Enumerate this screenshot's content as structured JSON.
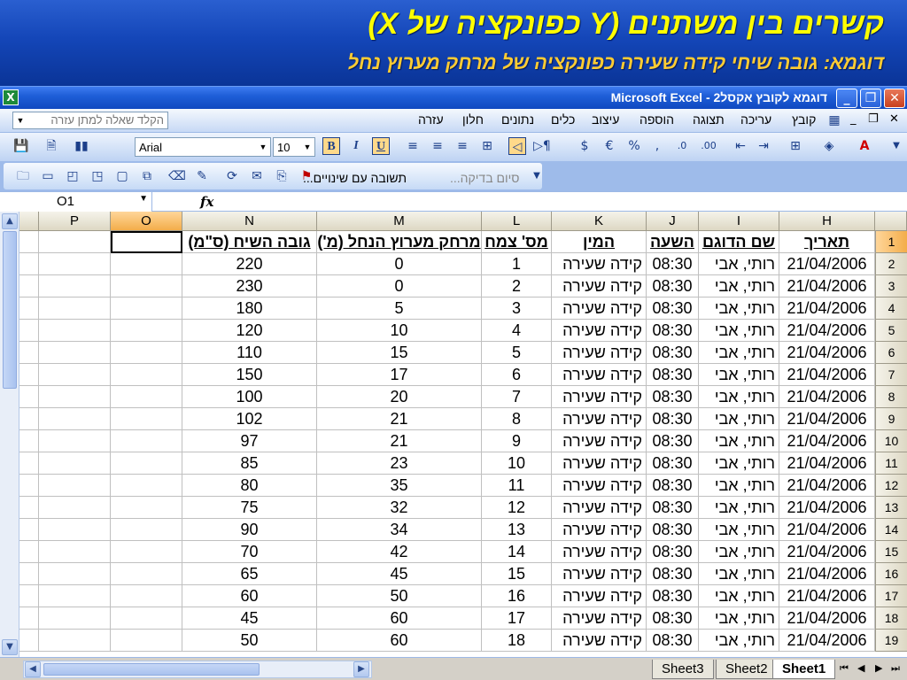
{
  "slide": {
    "title": "קשרים בין משתנים (Y כפונקציה של X)",
    "subtitle": "דוגמא: גובה שיחי קידה שעירה כפונקציה של מרחק מערוץ נחל"
  },
  "window": {
    "title": "Microsoft Excel - דוגמא לקובץ אקסל2",
    "minimize": "_",
    "restore": "❐",
    "close": "✕"
  },
  "menu": {
    "items": [
      "קובץ",
      "עריכה",
      "תצוגה",
      "הוספה",
      "עיצוב",
      "כלים",
      "נתונים",
      "חלון",
      "עזרה"
    ],
    "help_placeholder": "הקלד שאלה למתן עזרה"
  },
  "toolbar": {
    "font_name": "Arial",
    "font_size": "10",
    "bold": "B",
    "italic": "I",
    "underline": "U",
    "currency": "€",
    "percent": "%",
    "comma": ",",
    "review_reply": "תשובה עם שינויים...",
    "review_end": "סיום בדיקה..."
  },
  "formula_bar": {
    "name_box": "O1",
    "fx": "fx",
    "content": ""
  },
  "columns": [
    "H",
    "I",
    "J",
    "K",
    "L",
    "M",
    "N",
    "O",
    "P"
  ],
  "selected_column": "O",
  "headers": {
    "H": "תאריך",
    "I": "שם הדוגם",
    "J": "השעה",
    "K": "המין",
    "L": "מס' צמח",
    "M": "מרחק מערוץ הנחל (מ')",
    "N": "גובה השיח (ס\"מ)"
  },
  "rows": [
    {
      "num": "2",
      "date": "21/04/2006",
      "sampler": "רותי, אבי",
      "time": "08:30",
      "species": "קידה שעירה",
      "plant": "1",
      "distance": "0",
      "height": "220"
    },
    {
      "num": "3",
      "date": "21/04/2006",
      "sampler": "רותי, אבי",
      "time": "08:30",
      "species": "קידה שעירה",
      "plant": "2",
      "distance": "0",
      "height": "230"
    },
    {
      "num": "4",
      "date": "21/04/2006",
      "sampler": "רותי, אבי",
      "time": "08:30",
      "species": "קידה שעירה",
      "plant": "3",
      "distance": "5",
      "height": "180"
    },
    {
      "num": "5",
      "date": "21/04/2006",
      "sampler": "רותי, אבי",
      "time": "08:30",
      "species": "קידה שעירה",
      "plant": "4",
      "distance": "10",
      "height": "120"
    },
    {
      "num": "6",
      "date": "21/04/2006",
      "sampler": "רותי, אבי",
      "time": "08:30",
      "species": "קידה שעירה",
      "plant": "5",
      "distance": "15",
      "height": "110"
    },
    {
      "num": "7",
      "date": "21/04/2006",
      "sampler": "רותי, אבי",
      "time": "08:30",
      "species": "קידה שעירה",
      "plant": "6",
      "distance": "17",
      "height": "150"
    },
    {
      "num": "8",
      "date": "21/04/2006",
      "sampler": "רותי, אבי",
      "time": "08:30",
      "species": "קידה שעירה",
      "plant": "7",
      "distance": "20",
      "height": "100"
    },
    {
      "num": "9",
      "date": "21/04/2006",
      "sampler": "רותי, אבי",
      "time": "08:30",
      "species": "קידה שעירה",
      "plant": "8",
      "distance": "21",
      "height": "102"
    },
    {
      "num": "10",
      "date": "21/04/2006",
      "sampler": "רותי, אבי",
      "time": "08:30",
      "species": "קידה שעירה",
      "plant": "9",
      "distance": "21",
      "height": "97"
    },
    {
      "num": "11",
      "date": "21/04/2006",
      "sampler": "רותי, אבי",
      "time": "08:30",
      "species": "קידה שעירה",
      "plant": "10",
      "distance": "23",
      "height": "85"
    },
    {
      "num": "12",
      "date": "21/04/2006",
      "sampler": "רותי, אבי",
      "time": "08:30",
      "species": "קידה שעירה",
      "plant": "11",
      "distance": "35",
      "height": "80"
    },
    {
      "num": "13",
      "date": "21/04/2006",
      "sampler": "רותי, אבי",
      "time": "08:30",
      "species": "קידה שעירה",
      "plant": "12",
      "distance": "32",
      "height": "75"
    },
    {
      "num": "14",
      "date": "21/04/2006",
      "sampler": "רותי, אבי",
      "time": "08:30",
      "species": "קידה שעירה",
      "plant": "13",
      "distance": "34",
      "height": "90"
    },
    {
      "num": "15",
      "date": "21/04/2006",
      "sampler": "רותי, אבי",
      "time": "08:30",
      "species": "קידה שעירה",
      "plant": "14",
      "distance": "42",
      "height": "70"
    },
    {
      "num": "16",
      "date": "21/04/2006",
      "sampler": "רותי, אבי",
      "time": "08:30",
      "species": "קידה שעירה",
      "plant": "15",
      "distance": "45",
      "height": "65"
    },
    {
      "num": "17",
      "date": "21/04/2006",
      "sampler": "רותי, אבי",
      "time": "08:30",
      "species": "קידה שעירה",
      "plant": "16",
      "distance": "50",
      "height": "60"
    },
    {
      "num": "18",
      "date": "21/04/2006",
      "sampler": "רותי, אבי",
      "time": "08:30",
      "species": "קידה שעירה",
      "plant": "17",
      "distance": "60",
      "height": "45"
    },
    {
      "num": "19",
      "date": "21/04/2006",
      "sampler": "רותי, אבי",
      "time": "08:30",
      "species": "קידה שעירה",
      "plant": "18",
      "distance": "60",
      "height": "50"
    }
  ],
  "header_row_num": "1",
  "sheets": [
    "Sheet3",
    "Sheet2",
    "Sheet1"
  ],
  "active_sheet": "Sheet1",
  "colors": {
    "title": "#ffff00",
    "subtitle": "#ffcc33",
    "selection": "#f3ad4a"
  }
}
